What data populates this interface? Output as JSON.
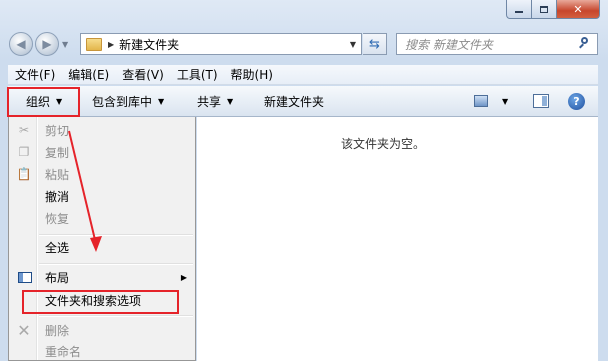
{
  "address_bar": {
    "path": "新建文件夹",
    "search_placeholder": "搜索 新建文件夹"
  },
  "menubar": {
    "items": [
      "文件(F)",
      "编辑(E)",
      "查看(V)",
      "工具(T)",
      "帮助(H)"
    ]
  },
  "toolbar": {
    "organize": "组织",
    "include_in_library": "包含到库中",
    "share": "共享",
    "new_folder": "新建文件夹"
  },
  "content": {
    "empty_message": "该文件夹为空。"
  },
  "organize_menu": {
    "cut": "剪切",
    "copy": "复制",
    "paste": "粘贴",
    "undo": "撤消",
    "redo": "恢复",
    "select_all": "全选",
    "layout": "布局",
    "folder_options": "文件夹和搜索选项",
    "delete": "删除",
    "rename": "重命名"
  },
  "colors": {
    "highlight_red": "#e5232a",
    "window_frame": "#cddcee"
  }
}
